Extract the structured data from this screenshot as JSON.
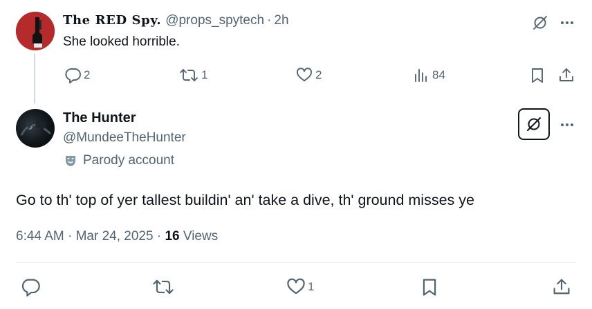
{
  "parent_tweet": {
    "display_name": "The RED Spy.",
    "handle": "@props_spytech",
    "separator": "·",
    "time": "2h",
    "text": "She looked horrible.",
    "replies": "2",
    "reposts": "1",
    "likes": "2",
    "views": "84"
  },
  "main_tweet": {
    "display_name": "The Hunter",
    "handle": "@MundeeTheHunter",
    "parody_label": "Parody account",
    "text": "Go to th' top of yer tallest buildin' an' take a dive, th' ground misses ye",
    "timestamp": "6:44 AM · Mar 24, 2025 · ",
    "views_count": "16",
    "views_label": " Views",
    "likes": "1"
  },
  "icons": {
    "reply": "reply-icon",
    "repost": "repost-icon",
    "like": "like-icon",
    "views": "views-icon",
    "bookmark": "bookmark-icon",
    "share": "share-icon",
    "grok": "grok-icon",
    "more": "more-icon",
    "parody": "parody-mask-icon"
  },
  "colors": {
    "text_primary": "#0f1419",
    "text_secondary": "#536471",
    "thread_line": "#cfd9de",
    "divider": "#eff3f4"
  }
}
